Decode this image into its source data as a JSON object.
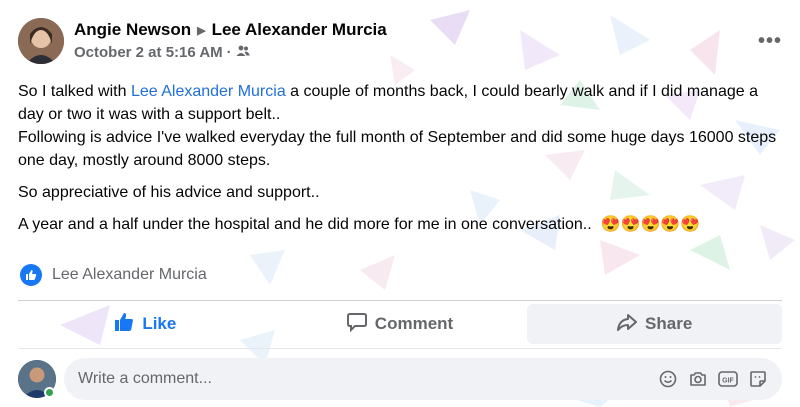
{
  "post": {
    "author": "Angie Newson",
    "recipient": "Lee Alexander Murcia",
    "timestamp": "October 2 at 5:16 AM",
    "separator": "·",
    "audience_icon": "friends-icon",
    "more_label": "•••"
  },
  "body": {
    "p1_before": "So I talked with ",
    "p1_mention": "Lee Alexander Murcia",
    "p1_after": " a couple of months back,  I could bearly walk and if I did manage a day or two it was with a support  belt..",
    "p1_line2": "Following is advice I've walked everyday the full month of September and did some huge days 16000 steps one day, mostly around 8000 steps.",
    "p2": "So appreciative of his advice and support..",
    "p3": "A year and a half under the hospital and he did more for me in one conversation..",
    "p3_emojis": "😍😍😍😍😍"
  },
  "tag": {
    "name": "Lee Alexander Murcia",
    "icon": "like-badge-icon"
  },
  "actions": {
    "like": "Like",
    "comment": "Comment",
    "share": "Share"
  },
  "comment_input": {
    "placeholder": "Write a comment...",
    "icons": [
      "emoji-icon",
      "camera-icon",
      "gif-icon",
      "sticker-icon"
    ]
  },
  "colors": {
    "accent": "#1877f2",
    "mention": "#216fdb",
    "text": "#050505",
    "muted": "#65676b",
    "online": "#31a24c"
  }
}
